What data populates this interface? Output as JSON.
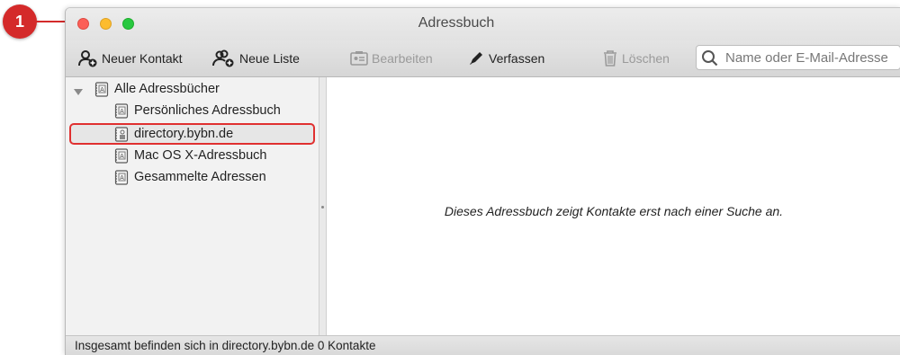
{
  "callout": {
    "number": "1"
  },
  "window": {
    "title": "Adressbuch"
  },
  "toolbar": {
    "new_contact": "Neuer Kontakt",
    "new_list": "Neue Liste",
    "edit": "Bearbeiten",
    "compose": "Verfassen",
    "delete": "Löschen",
    "search_placeholder": "Name oder E-Mail-Adresse"
  },
  "sidebar": {
    "root": "Alle Adressbücher",
    "items": [
      {
        "label": "Persönliches Adressbuch"
      },
      {
        "label": "directory.bybn.de"
      },
      {
        "label": "Mac OS X-Adressbuch"
      },
      {
        "label": "Gesammelte Adressen"
      }
    ]
  },
  "main": {
    "empty_message": "Dieses Adressbuch zeigt Kontakte erst nach einer Suche an."
  },
  "status": {
    "text": "Insgesamt befinden sich in directory.bybn.de 0 Kontakte"
  },
  "colors": {
    "callout": "#d42a2a",
    "selection_outline": "#e03030"
  },
  "icons": [
    "contact-add-icon",
    "list-add-icon",
    "edit-card-icon",
    "pen-icon",
    "trash-icon",
    "search-icon",
    "addressbook-icon",
    "ldap-addressbook-icon",
    "disclosure-triangle-icon"
  ]
}
